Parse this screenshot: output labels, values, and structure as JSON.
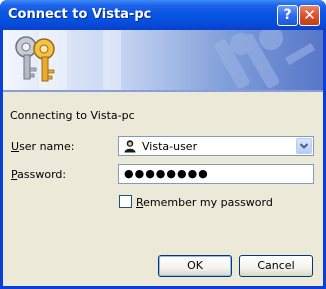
{
  "window": {
    "title": "Connect to Vista-pc",
    "help_glyph": "?",
    "close_glyph": "✕"
  },
  "banner": {
    "icon": "keys-icon"
  },
  "dialog": {
    "connecting_text": "Connecting to Vista-pc",
    "username_label_u": "U",
    "username_label_rest": "ser name:",
    "username_value": "Vista-user",
    "password_label_u": "P",
    "password_label_rest": "assword:",
    "password_masked": "●●●●●●●●",
    "remember_label_u": "R",
    "remember_label_rest": "emember my password",
    "remember_checked": false,
    "ok_label": "OK",
    "cancel_label": "Cancel"
  },
  "colors": {
    "titlebar": "#0a54e3",
    "client_bg": "#ece9d8",
    "field_border": "#7f9db9"
  }
}
